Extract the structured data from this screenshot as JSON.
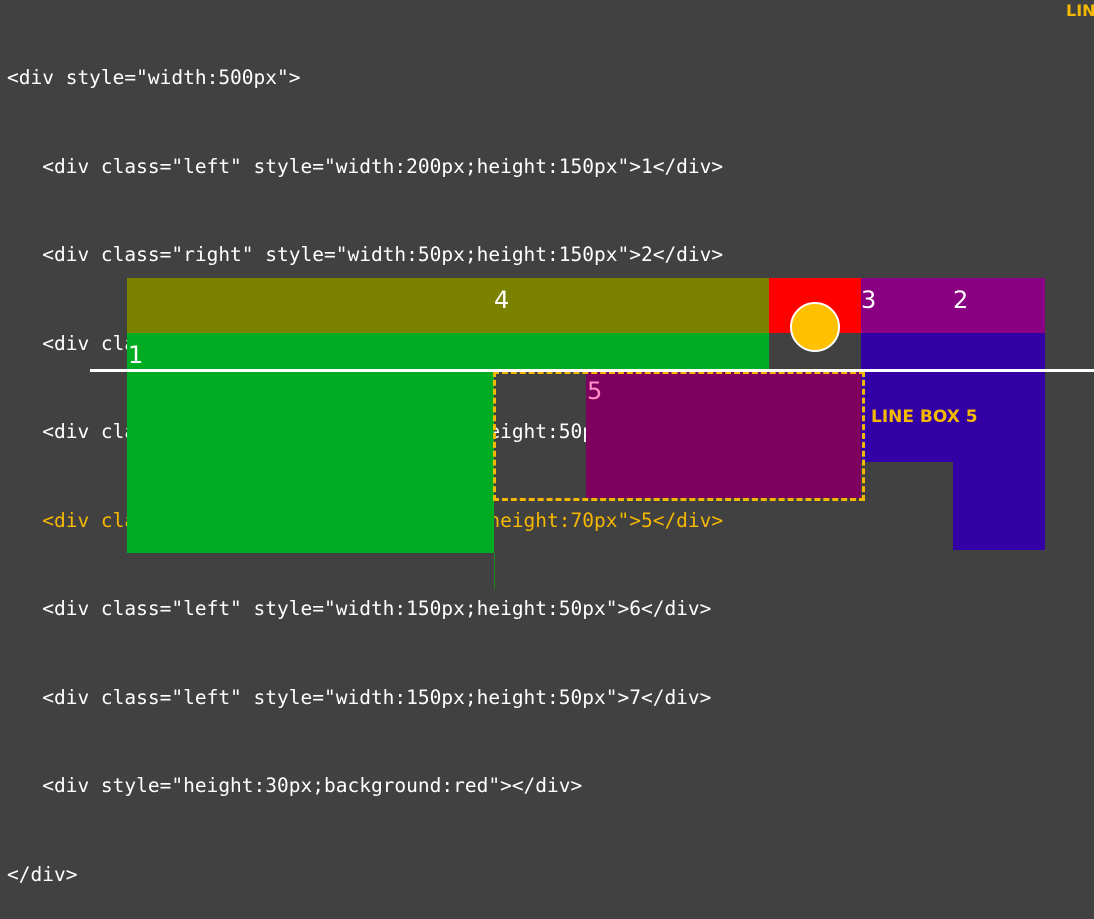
{
  "code_lines": [
    "<div style=\"width:500px\">",
    "   <div class=\"left\" style=\"width:200px;height:150px\">1</div>",
    "   <div class=\"right\" style=\"width:50px;height:150px\">2</div>",
    "   <div class=\"right\" style=\"width:50px;height:100px\">3</div>",
    "   <div class=\"left\" style=\"width:150px;height:50px\">4</div>",
    "   <div class=\"right\" style=\"width:150px;height:70px\">5</div>",
    "   <div class=\"left\" style=\"width:150px;height:50px\">6</div>",
    "   <div class=\"left\" style=\"width:150px;height:50px\">7</div>",
    "   <div style=\"height:30px;background:red\"></div>",
    "</div>"
  ],
  "highlighted_line_index": 4,
  "corner_label": "LIN",
  "box_labels": {
    "box1": "1",
    "box2": "2",
    "box3": "3",
    "box4": "4",
    "box5": "5"
  },
  "line_box_label": "LINE BOX 5",
  "colors": {
    "background": "#414141",
    "highlight": "#f5b800",
    "box1": "#00ad22",
    "box4": "#7b8200",
    "red_div": "#ff0000",
    "box2_3": "#8a0082",
    "blue": "#3300a6",
    "box5": "#7e005f",
    "marker": "#ffc000"
  }
}
